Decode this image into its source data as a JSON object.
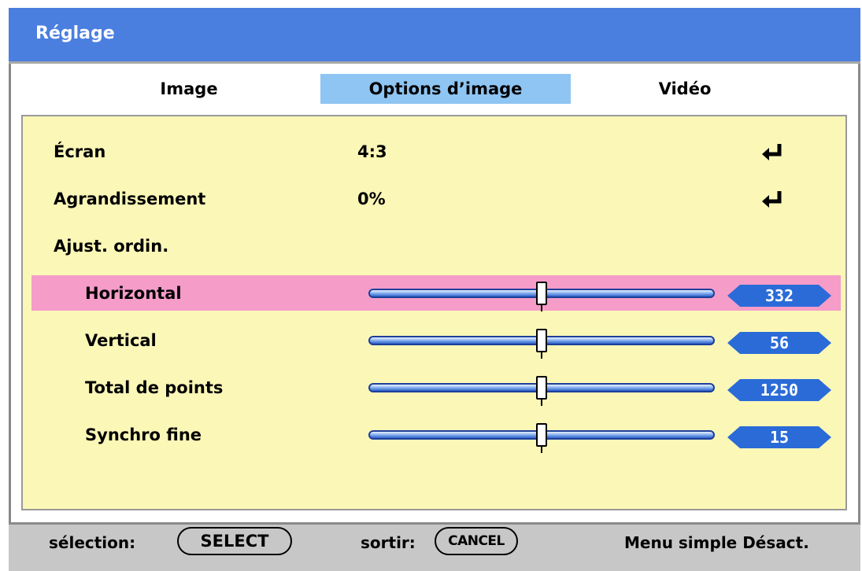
{
  "window": {
    "title": "Réglage"
  },
  "tabs": [
    {
      "label": "Image",
      "active": false
    },
    {
      "label": "Options d’image",
      "active": true
    },
    {
      "label": "Vidéo",
      "active": false
    }
  ],
  "menu": {
    "rows": [
      {
        "label": "Écran",
        "value": "4:3",
        "icon": "enter-arrow-icon"
      },
      {
        "label": "Agrandissement",
        "value": "0%",
        "icon": "enter-arrow-icon"
      },
      {
        "label": "Ajust. ordin."
      }
    ],
    "sliders": [
      {
        "label": "Horizontal",
        "value": "332",
        "level": 0.5,
        "selected": true
      },
      {
        "label": "Vertical",
        "value": "56",
        "level": 0.5,
        "selected": false
      },
      {
        "label": "Total de points",
        "value": "1250",
        "level": 0.5,
        "selected": false
      },
      {
        "label": "Synchro fine",
        "value": "15",
        "level": 0.5,
        "selected": false
      }
    ]
  },
  "footer": {
    "select_prefix": "sélection:",
    "select_button": "SELECT",
    "exit_prefix": "sortir:",
    "cancel_button": "CANCEL",
    "menu_mode": "Menu simple Désact."
  },
  "colors": {
    "title_bar": "#4a7fe0",
    "active_tab": "#8ec5f3",
    "panel_bg": "#fbf7b7",
    "selected_row": "#f59cc9",
    "value_badge": "#2a6bd8",
    "footer_bg": "#c7c7c7"
  }
}
